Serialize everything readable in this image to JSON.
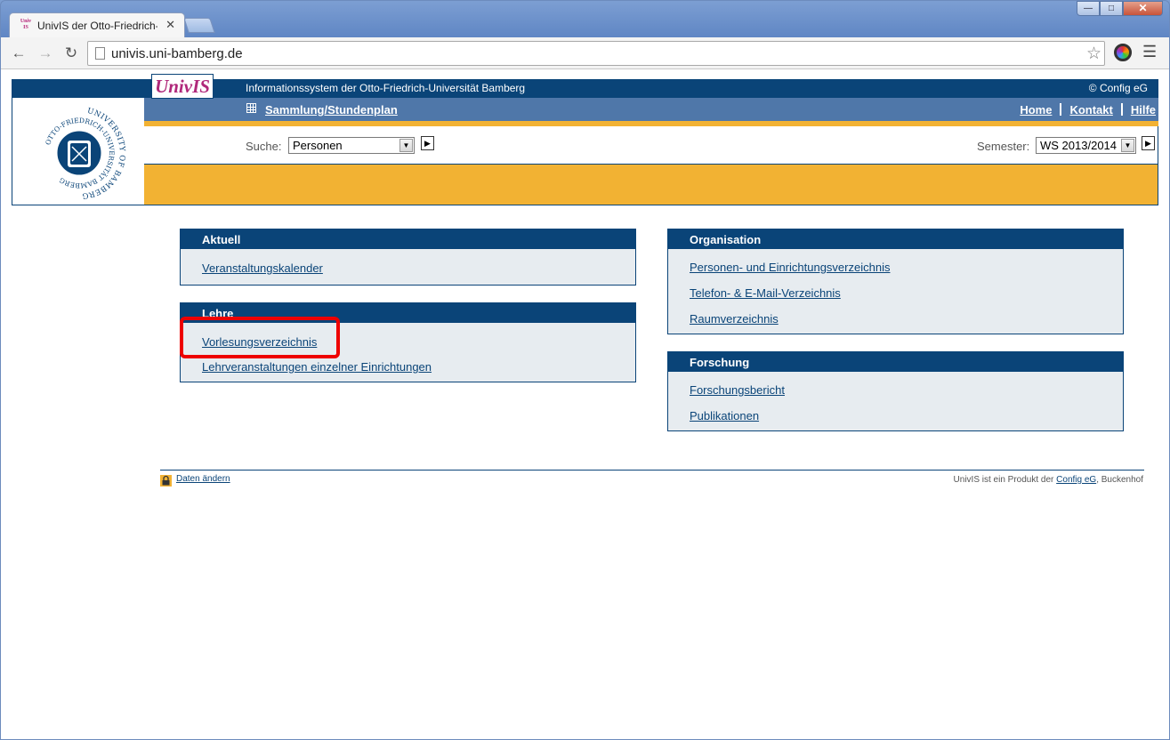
{
  "browser": {
    "tab_title": "UnivIS der Otto-Friedrich-",
    "tab_favicon_text": "Univ IS",
    "url": "univis.uni-bamberg.de",
    "window_controls": {
      "minimize": "—",
      "maximize": "□",
      "close": "✕"
    }
  },
  "header": {
    "logo_text": "UnivIS",
    "info_text": "Informationssystem der Otto-Friedrich-Universität Bamberg",
    "copyright": "© Config eG",
    "sammlung_link": "Sammlung/Stundenplan",
    "top_links": {
      "home": "Home",
      "kontakt": "Kontakt",
      "hilfe": "Hilfe"
    },
    "seal_text": "UNIVERSITY OF BAMBERG · OTTO-FRIEDRICH-UNIVERSITÄT BAMBERG"
  },
  "search": {
    "suche_label": "Suche:",
    "suche_value": "Personen",
    "semester_label": "Semester:",
    "semester_value": "WS 2013/2014"
  },
  "boxes": {
    "aktuell": {
      "title": "Aktuell",
      "links": [
        "Veranstaltungskalender"
      ]
    },
    "lehre": {
      "title": "Lehre",
      "links": [
        "Vorlesungsverzeichnis",
        "Lehrveranstaltungen einzelner Einrichtungen"
      ]
    },
    "organisation": {
      "title": "Organisation",
      "links": [
        "Personen- und Einrichtungsverzeichnis",
        "Telefon- & E-Mail-Verzeichnis",
        "Raumverzeichnis"
      ]
    },
    "forschung": {
      "title": "Forschung",
      "links": [
        "Forschungsbericht",
        "Publikationen"
      ]
    }
  },
  "footer": {
    "daten_link": "Daten ändern",
    "product_text": "UnivIS ist ein Produkt der",
    "config_link": "Config eG",
    "location": ", Buckenhof"
  },
  "colors": {
    "navy": "#0a4478",
    "gold": "#f2b233",
    "highlight": "#ee0000",
    "logo_magenta": "#b0287a"
  }
}
